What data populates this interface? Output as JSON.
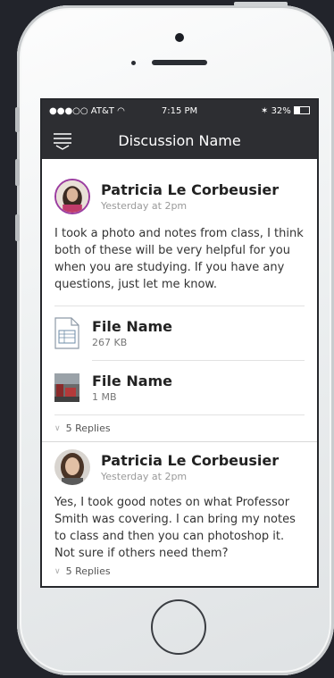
{
  "status_bar": {
    "carrier": "●●●○○ AT&T",
    "time": "7:15 PM",
    "battery": "32%"
  },
  "nav": {
    "title": "Discussion Name",
    "menu_icon": "menu-icon"
  },
  "posts": [
    {
      "author": "Patricia Le Corbeusier",
      "time": "Yesterday at 2pm",
      "text": "I took a photo and notes from class, I think both of these will be very helpful for you when you are studying.  If you have any questions, just let me know.",
      "files": [
        {
          "name": "File Name",
          "size": "267 KB",
          "icon": "document-icon"
        },
        {
          "name": "File Name",
          "size": "1 MB",
          "icon": "image-thumbnail-icon"
        }
      ],
      "replies": "5 Replies"
    },
    {
      "author": "Patricia Le Corbeusier",
      "time": "Yesterday at 2pm",
      "text": "Yes, I took good notes on what Professor Smith was covering.  I can bring my notes to class and then you can photoshop it. Not sure if others need them?",
      "replies": "5 Replies"
    }
  ],
  "colors": {
    "nav_bg": "#2d2e32",
    "avatar_ring": "#9b3da0"
  }
}
